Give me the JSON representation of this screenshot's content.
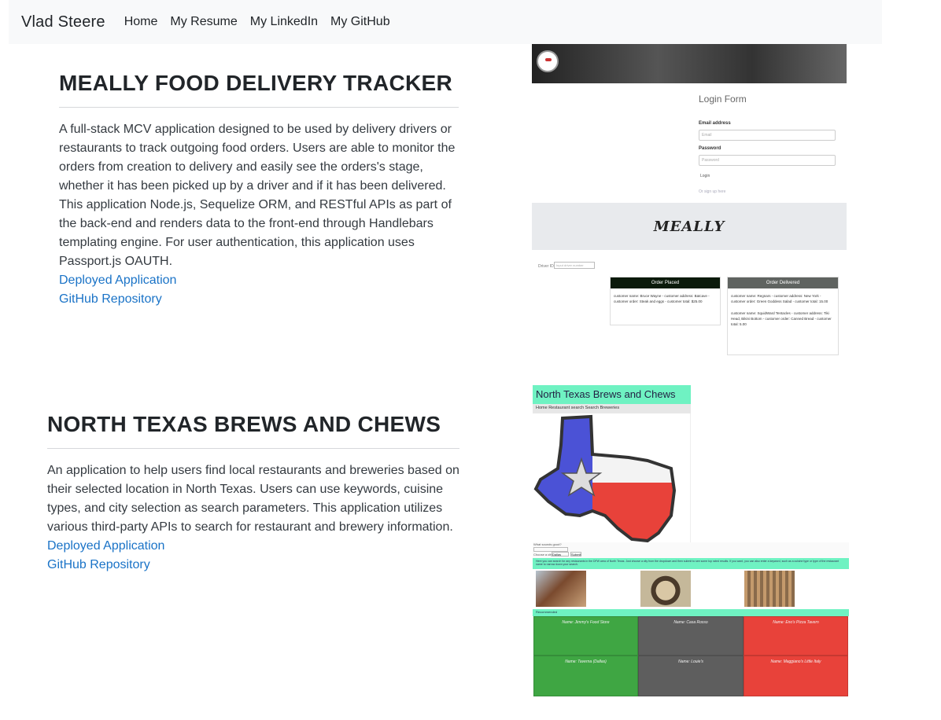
{
  "navbar": {
    "brand": "Vlad Steere",
    "links": [
      "Home",
      "My Resume",
      "My LinkedIn",
      "My GitHub"
    ]
  },
  "projects": [
    {
      "title": "MEALLY FOOD DELIVERY TRACKER",
      "description": "A full-stack MCV application designed to be used by delivery drivers or restaurants to track outgoing food orders. Users are able to monitor the orders from creation to delivery and easily see the orders's stage, whether it has been picked up by a driver and if it has been delivered. This application Node.js, Sequelize ORM, and RESTful APIs as part of the back-end and renders data to the front-end through Handlebars templating engine. For user authentication, this application uses Passport.js OAUTH.",
      "deploy_link": "Deployed Application",
      "repo_link": "GitHub Repository"
    },
    {
      "title": "NORTH TEXAS BREWS AND CHEWS",
      "description": "An application to help users find local restaurants and breweries based on their selected location in North Texas. Users can use keywords, cuisine types, and city selection as search parameters. This application utilizes various third-party APIs to search for restaurant and brewery information.",
      "deploy_link": "Deployed Application",
      "repo_link": "GitHub Repository"
    }
  ],
  "screenshot1": {
    "login_title": "Login Form",
    "email_label": "Email address",
    "email_placeholder": "Email",
    "password_label": "Password",
    "password_placeholder": "Password",
    "login_button": "Login",
    "signup_link": "Or sign up here",
    "banner": "MEALLY",
    "driver_label": "Driver ID",
    "driver_placeholder": "Input driver number",
    "col1_title": "Order Placed",
    "col1_body": "customer name: Bruce Wayne - customer address: Batcave - customer order: Steak and eggs - customer total: $25.00",
    "col2_title": "Order Delivered",
    "col2_body1": "customer name: Regnars - customer address: New York - customer order: Green Goddess Salad - customer total: 15.00",
    "col2_body2": "customer name: SquidWard Tentacles - customer address: Tiki Head, Bikini Bottom - customer order: Canned Bread - customer total: 5.00"
  },
  "screenshot2": {
    "header": "North Texas Brews and Chews",
    "nav": "Home    Restaurant search    Search Breweries",
    "search_label": "What sounds good?",
    "city_label": "Choose a city",
    "city_value": "Dallas",
    "submit": "Submit",
    "stripe": "Here you can search for any restaurants in the DFW area of North Texas. Just choose a city from the dropdown and then submit to see some top rated results. If you want, you can also enter a keyword, such as a cuisine type or type of the restaurant name to narrow down your search.",
    "recommended": "Recommended",
    "tiles": [
      {
        "name": "Name: Jimmy's Food Store",
        "color": "#3fa643"
      },
      {
        "name": "Name: Casa Rosso",
        "color": "#5e5e5e"
      },
      {
        "name": "Name: Eno's Pizza Tavern",
        "color": "#e8423a"
      },
      {
        "name": "Name: Taverna (Dallas)",
        "color": "#3fa643"
      },
      {
        "name": "Name: Louie's",
        "color": "#5e5e5e"
      },
      {
        "name": "Name: Maggiano's Little Italy",
        "color": "#e8423a"
      }
    ]
  },
  "colors": {
    "link": "#1a73c7",
    "navbar_bg": "#f8f9fa",
    "accent_teal": "#6ff2c2"
  }
}
